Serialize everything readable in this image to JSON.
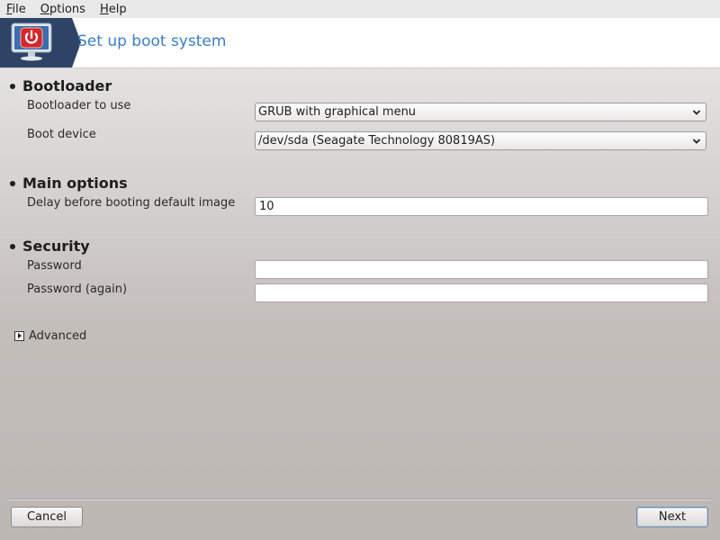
{
  "menubar": {
    "items": [
      {
        "mnemonic": "F",
        "rest": "ile"
      },
      {
        "mnemonic": "O",
        "rest": "ptions"
      },
      {
        "mnemonic": "H",
        "rest": "elp"
      }
    ]
  },
  "banner": {
    "title": "Set up boot system",
    "icon": "power-monitor-icon"
  },
  "sections": {
    "bootloader": {
      "title": "Bootloader",
      "bootloader_label": "Bootloader to use",
      "bootloader_value": "GRUB with graphical menu",
      "device_label": "Boot device",
      "device_value": "/dev/sda (Seagate Technology 80819AS)"
    },
    "main_options": {
      "title": "Main options",
      "delay_label": "Delay before booting default image",
      "delay_value": "10"
    },
    "security": {
      "title": "Security",
      "password_label": "Password",
      "password_value": "",
      "password_again_label": "Password (again)",
      "password_again_value": ""
    }
  },
  "advanced": {
    "label": "Advanced",
    "expanded": false
  },
  "buttons": {
    "cancel": "Cancel",
    "next": "Next"
  },
  "colors": {
    "accent": "#3c7dc4",
    "logo_bg": "#2d4466",
    "power_red": "#d3282b"
  }
}
